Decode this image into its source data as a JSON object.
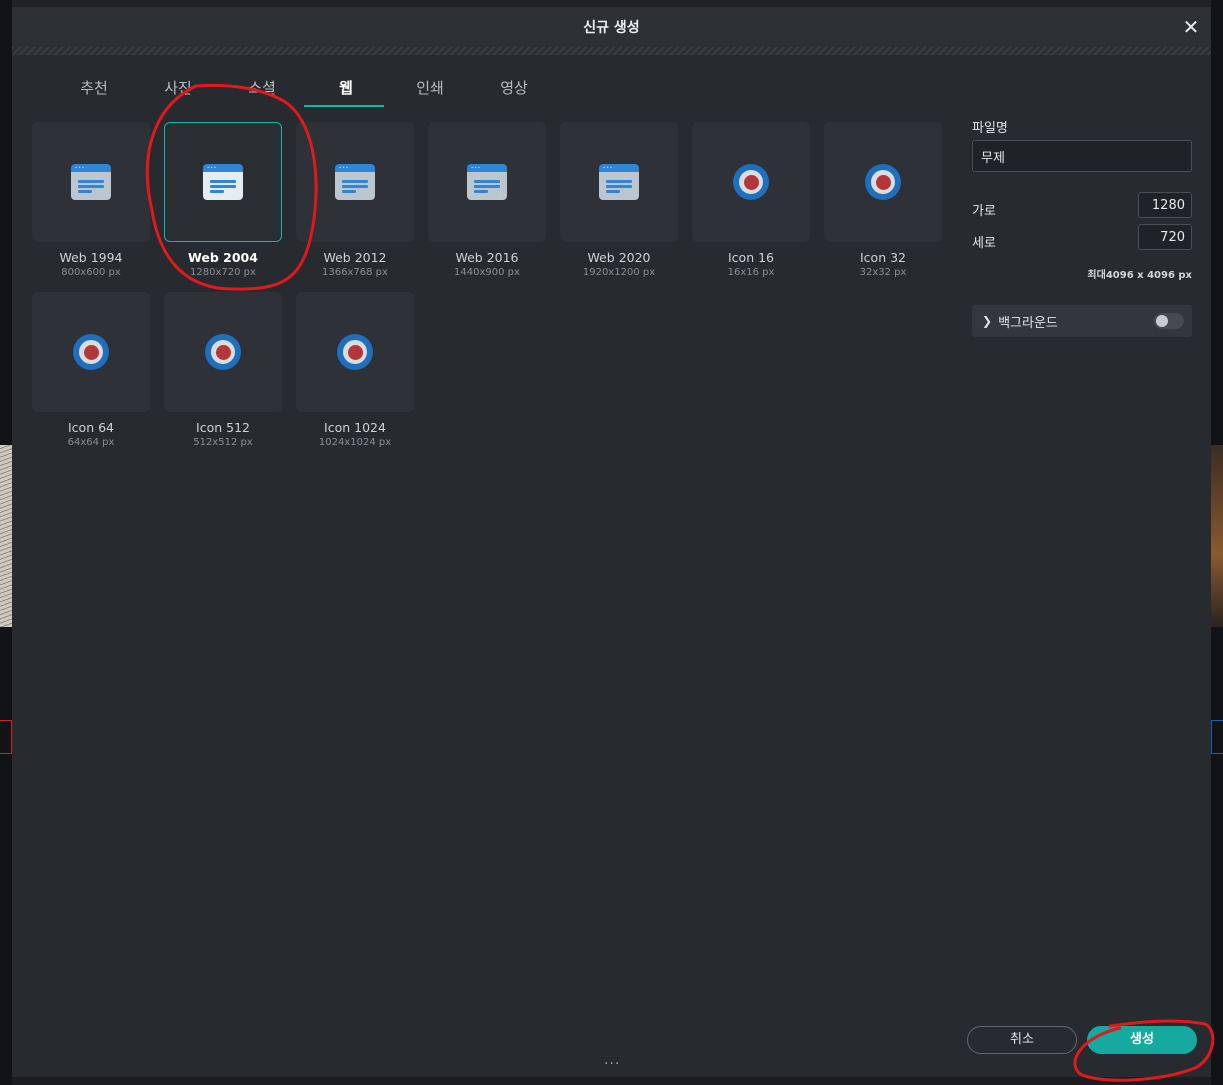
{
  "dialog": {
    "title": "신규 생성",
    "close_icon": "close-icon"
  },
  "tabs": [
    {
      "label": "추천",
      "active": false
    },
    {
      "label": "사진",
      "active": false
    },
    {
      "label": "소셜",
      "active": false
    },
    {
      "label": "웹",
      "active": true
    },
    {
      "label": "인쇄",
      "active": false
    },
    {
      "label": "영상",
      "active": false
    }
  ],
  "presets": [
    {
      "name": "Web 1994",
      "size": "800x600 px",
      "icon": "web-browser-icon",
      "selected": false
    },
    {
      "name": "Web 2004",
      "size": "1280x720 px",
      "icon": "web-browser-icon",
      "selected": true
    },
    {
      "name": "Web 2012",
      "size": "1366x768 px",
      "icon": "web-browser-icon",
      "selected": false
    },
    {
      "name": "Web 2016",
      "size": "1440x900 px",
      "icon": "web-browser-icon",
      "selected": false
    },
    {
      "name": "Web 2020",
      "size": "1920x1200 px",
      "icon": "web-browser-icon",
      "selected": false
    },
    {
      "name": "Icon 16",
      "size": "16x16 px",
      "icon": "target-icon",
      "selected": false
    },
    {
      "name": "Icon 32",
      "size": "32x32 px",
      "icon": "target-icon",
      "selected": false
    },
    {
      "name": "Icon 64",
      "size": "64x64 px",
      "icon": "target-icon",
      "selected": false
    },
    {
      "name": "Icon 512",
      "size": "512x512 px",
      "icon": "target-icon",
      "selected": false
    },
    {
      "name": "Icon 1024",
      "size": "1024x1024 px",
      "icon": "target-icon",
      "selected": false
    }
  ],
  "panel": {
    "filename_label": "파일명",
    "filename_value": "무제",
    "width_label": "가로",
    "width_value": "1280",
    "height_label": "세로",
    "height_value": "720",
    "max_note": "최대4096 x 4096 px",
    "background_label": "백그라운드",
    "background_enabled": false
  },
  "footer": {
    "cancel_label": "취소",
    "create_label": "생성",
    "more_label": "..."
  },
  "colors": {
    "accent": "#15a9a0",
    "annotation": "#e0191c",
    "web_icon_blue": "#2f86d6",
    "target_outer": "#1e6fbd",
    "target_center": "#b53638"
  }
}
